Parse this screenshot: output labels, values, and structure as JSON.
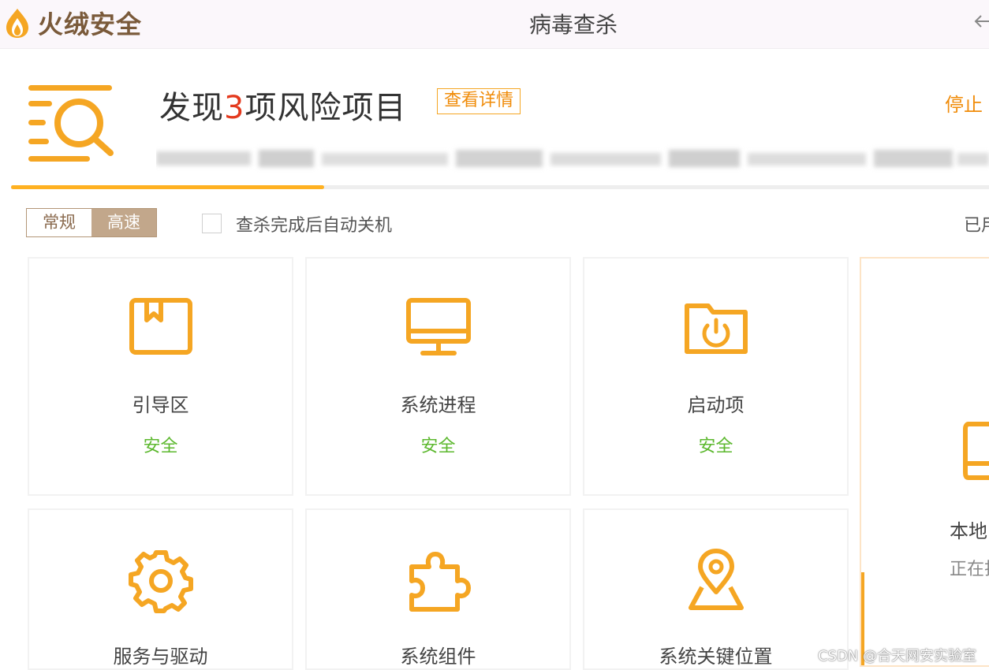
{
  "app": {
    "name": "火绒安全",
    "window_title": "病毒查杀"
  },
  "header": {
    "prefix": "发现",
    "count": "3",
    "suffix": "项风险项目",
    "details_button": "查看详情",
    "stop_button": "停止"
  },
  "progress": {
    "fraction": 0.32
  },
  "options": {
    "mode_normal": "常规",
    "mode_fast": "高速",
    "mode_selected": "高速",
    "auto_shutdown_label": "查杀完成后自动关机",
    "auto_shutdown_checked": false,
    "used_time_label": "已用"
  },
  "cards": [
    {
      "name": "引导区",
      "status": "安全",
      "icon": "boot-sector-icon"
    },
    {
      "name": "系统进程",
      "status": "安全",
      "icon": "monitor-icon"
    },
    {
      "name": "启动项",
      "status": "安全",
      "icon": "startup-folder-icon"
    },
    {
      "name": "服务与驱动",
      "status": "",
      "icon": "gear-icon"
    },
    {
      "name": "系统组件",
      "status": "",
      "icon": "puzzle-icon"
    },
    {
      "name": "系统关键位置",
      "status": "",
      "icon": "map-pin-icon"
    }
  ],
  "local_disk_card": {
    "name": "本地",
    "status": "正在扫",
    "icon": "hard-disk-icon"
  },
  "colors": {
    "accent": "#f5a623",
    "safe": "#5cb82e",
    "risk": "#e43a1e",
    "brown": "#c2a78b"
  },
  "watermark": "CSDN @合天网安实验室"
}
